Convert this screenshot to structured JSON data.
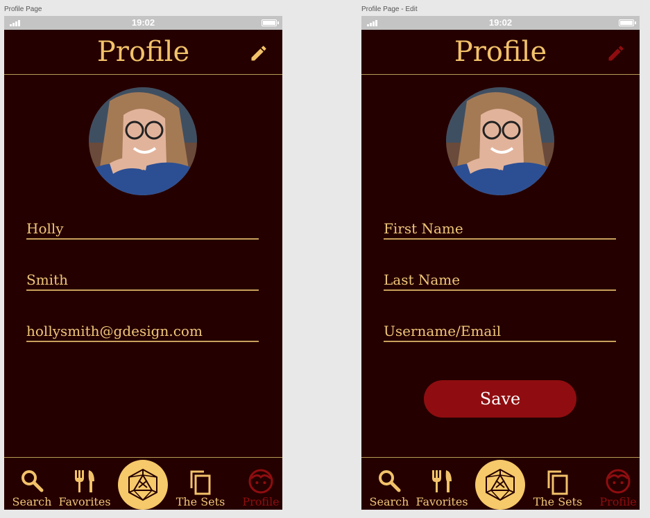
{
  "artboards": [
    {
      "label": "Profile Page",
      "status_time": "19:02",
      "title": "Profile",
      "fields": [
        "Holly",
        "Smith",
        "hollysmith@gdesign.com"
      ],
      "tabs": [
        "Search",
        "Favorites",
        "The Sets",
        "Profile"
      ]
    },
    {
      "label": "Profile Page - Edit",
      "status_time": "19:02",
      "title": "Profile",
      "fields": [
        "First Name",
        "Last Name",
        "Username/Email"
      ],
      "save_label": "Save",
      "tabs": [
        "Search",
        "Favorites",
        "The Sets",
        "Profile"
      ]
    }
  ],
  "icons": {
    "edit": "pencil-icon",
    "search": "search-icon",
    "favorites": "fork-knife-icon",
    "center": "d20-dice-icon",
    "sets": "copy-icon",
    "profile": "face-icon"
  },
  "colors": {
    "background": "#250000",
    "gold": "#f2c26a",
    "accent_red": "#8f0d10",
    "statusbar": "#c4c4c4"
  },
  "active_tab": "Profile"
}
